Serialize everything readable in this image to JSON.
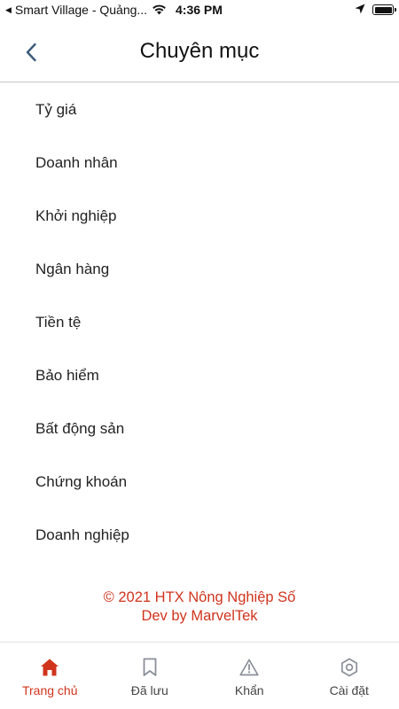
{
  "status_bar": {
    "carrier": "Smart Village - Quảng...",
    "time": "4:36 PM"
  },
  "header": {
    "title": "Chuyên mục"
  },
  "categories": [
    "Tỷ giá",
    "Doanh nhân",
    "Khởi nghiệp",
    "Ngân hàng",
    "Tiền tệ",
    "Bảo hiểm",
    "Bất động sản",
    "Chứng khoán",
    "Doanh nghiệp"
  ],
  "footer": {
    "copyright": "© 2021 HTX Nông Nghiệp Số",
    "dev": "Dev by MarvelTek"
  },
  "tabs": [
    {
      "label": "Trang chủ",
      "icon": "home-icon",
      "active": true
    },
    {
      "label": "Đã lưu",
      "icon": "bookmark-icon",
      "active": false
    },
    {
      "label": "Khẩn",
      "icon": "warning-icon",
      "active": false
    },
    {
      "label": "Cài đặt",
      "icon": "settings-icon",
      "active": false
    }
  ],
  "colors": {
    "accent": "#d0341d",
    "back_arrow": "#3c5a7a",
    "inactive_icon": "#8a8f99"
  }
}
